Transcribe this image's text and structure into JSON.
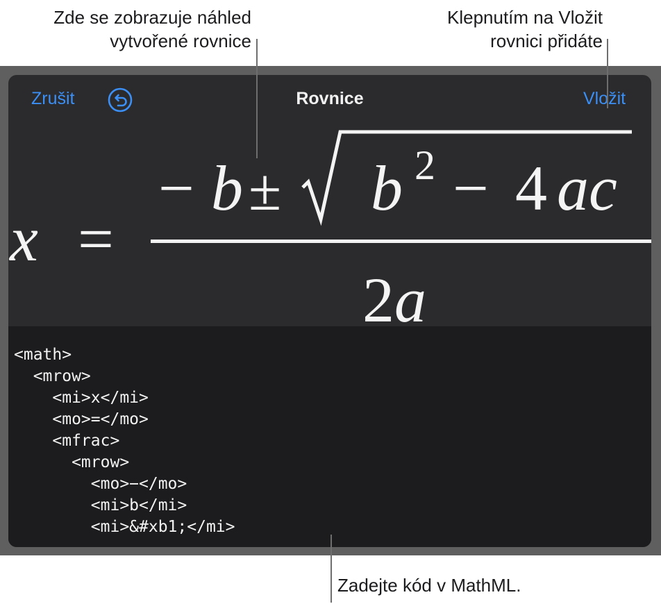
{
  "callouts": {
    "preview_line1": "Zde se zobrazuje náhled",
    "preview_line2": "vytvořené rovnice",
    "insert_line1": "Klepnutím na Vložit",
    "insert_line2": "rovnici přidáte",
    "code_hint": "Zadejte kód v MathML."
  },
  "toolbar": {
    "cancel_label": "Zrušit",
    "title": "Rovnice",
    "insert_label": "Vložit"
  },
  "equation": {
    "lhs": "x",
    "equals": "=",
    "numerator_minus": "−",
    "numerator_b": "b",
    "plus_minus": "±",
    "radicand_b": "b",
    "exponent": "2",
    "minus": "−",
    "four": "4",
    "ac": "ac",
    "denominator_two": "2",
    "denominator_a": "a"
  },
  "editor": {
    "code": "<math>\n  <mrow>\n    <mi>x</mi>\n    <mo>=</mo>\n    <mfrac>\n      <mrow>\n        <mo>−</mo>\n        <mi>b</mi>\n        <mi>&#xb1;</mi>"
  },
  "colors": {
    "accent": "#3b8ff5",
    "panel": "#2b2b2d",
    "editor": "#1c1c1e",
    "frame": "#5f5f5f"
  }
}
